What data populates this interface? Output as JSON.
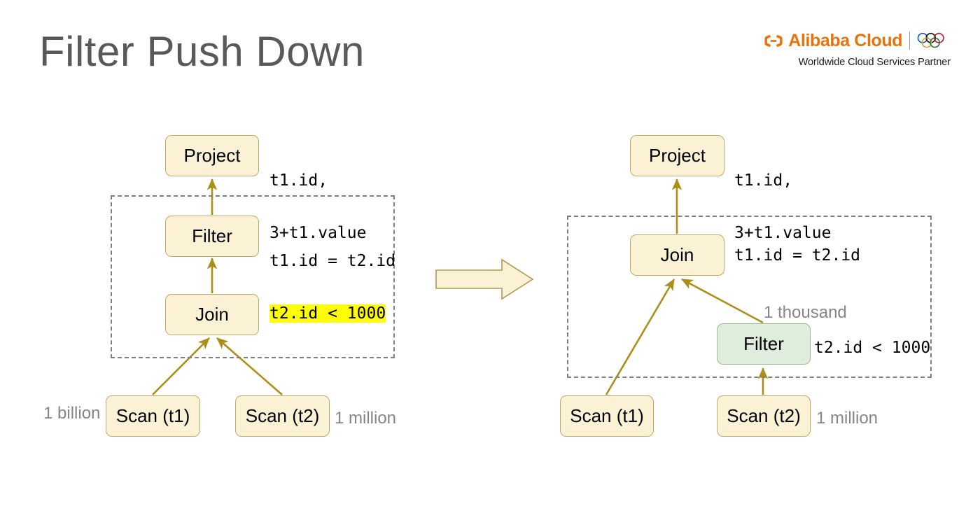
{
  "slide": {
    "title": "Filter Push Down"
  },
  "logo": {
    "mark_name": "alibaba-cloud-mark",
    "wordmark": "Alibaba Cloud",
    "tagline": "Worldwide Cloud Services Partner",
    "rings_name": "olympic-rings",
    "brand_color": "#E8730C",
    "ring_colors": [
      "#0A5EA8",
      "#111111",
      "#C8102E",
      "#E2A32B",
      "#1B7A3E"
    ]
  },
  "colors": {
    "node_fill": "#FBF2D5",
    "node_border": "#BFA96A",
    "node_fill_green": "#DFEDDC",
    "node_border_green": "#9BBB8E",
    "edge": "#AE8E17",
    "dashed_border": "#808080",
    "highlight": "#FFFF00",
    "label_gray": "#868686",
    "title_gray": "#595959"
  },
  "left_plan": {
    "name": "before-push-down",
    "nodes": [
      {
        "id": "project",
        "label": "Project"
      },
      {
        "id": "filter",
        "label": "Filter"
      },
      {
        "id": "join",
        "label": "Join"
      },
      {
        "id": "scan_t1",
        "label": "Scan (t1)"
      },
      {
        "id": "scan_t2",
        "label": "Scan (t2)"
      }
    ],
    "annotations": {
      "project_line1": "t1.id,",
      "project_line2": "3+t1.value",
      "filter_line1": "t1.id = t2.id",
      "filter_line2": "t2.id < 1000"
    },
    "cardinalities": {
      "scan_t1": "1 billion",
      "scan_t2": "1 million"
    }
  },
  "transform_arrow": {
    "name": "transform-arrow",
    "direction": "right"
  },
  "right_plan": {
    "name": "after-push-down",
    "nodes": [
      {
        "id": "project",
        "label": "Project"
      },
      {
        "id": "join",
        "label": "Join"
      },
      {
        "id": "filter",
        "label": "Filter"
      },
      {
        "id": "scan_t1",
        "label": "Scan (t1)"
      },
      {
        "id": "scan_t2",
        "label": "Scan (t2)"
      }
    ],
    "annotations": {
      "project_line1": "t1.id,",
      "project_line2": "3+t1.value",
      "join_cond": "t1.id = t2.id",
      "filter_cond": "t2.id < 1000"
    },
    "cardinalities": {
      "filter_out": "1 thousand",
      "scan_t2": "1 million"
    }
  }
}
